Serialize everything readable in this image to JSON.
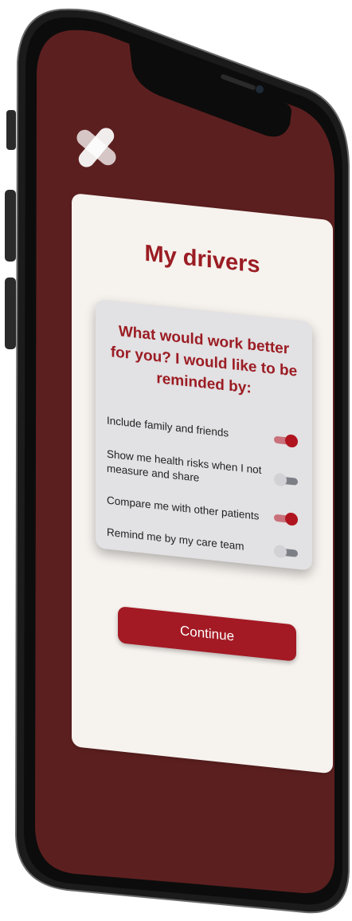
{
  "screen": {
    "background_color": "#5c1f1f",
    "logo": "four-petal-logo-icon"
  },
  "card": {
    "title": "My drivers",
    "question": "What would work better for you? I would like to be reminded by:",
    "options": [
      {
        "label": "Include family and friends",
        "enabled": true
      },
      {
        "label": "Show me health risks when I not measure and share",
        "enabled": false
      },
      {
        "label": "Compare me with other patients",
        "enabled": true
      },
      {
        "label": "Remind me by my care team",
        "enabled": false
      }
    ],
    "continue_label": "Continue"
  },
  "colors": {
    "accent": "#9b1c23",
    "card_bg": "#f6f2ee",
    "panel_bg": "#e2e1e3",
    "toggle_on": "#b0151f",
    "toggle_off": "#d2d2d6"
  }
}
